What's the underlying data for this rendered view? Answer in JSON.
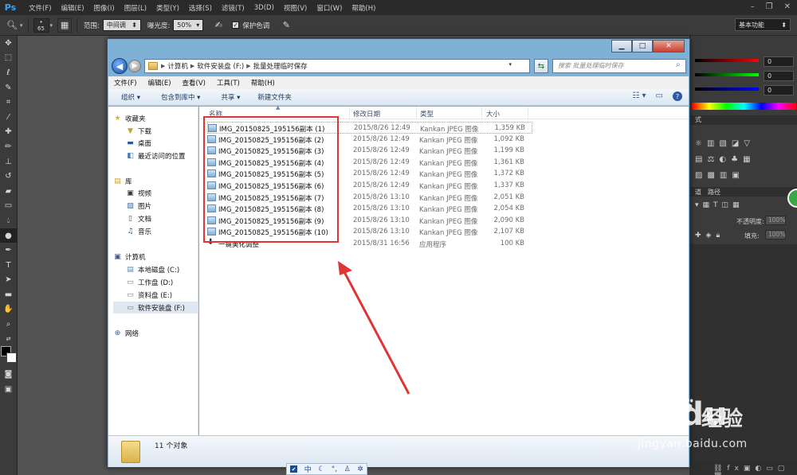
{
  "photoshop": {
    "logo": "Ps",
    "menu": [
      "文件(F)",
      "编辑(E)",
      "图像(I)",
      "图层(L)",
      "类型(Y)",
      "选择(S)",
      "滤镜(T)",
      "3D(D)",
      "视图(V)",
      "窗口(W)",
      "帮助(H)"
    ],
    "options": {
      "brush_size": "65",
      "range_label": "范围:",
      "range_value": "中间调",
      "exposure_label": "曝光度:",
      "exposure_value": "50%",
      "protect_tone_label": "保护色调"
    },
    "workspace": "基本功能",
    "right_panel": {
      "values": [
        "0",
        "0",
        "0"
      ],
      "tab_label": "式",
      "tabs2": [
        "道",
        "路径"
      ],
      "opacity_label": "不透明度:",
      "opacity_value": "100%",
      "fill_label": "填充:",
      "fill_value": "100%"
    },
    "accent_colors": {
      "blue": "#31a8ff",
      "green_badge": "#3aa845"
    }
  },
  "explorer": {
    "breadcrumb": [
      "计算机",
      "软件安装盘 (F:)",
      "批量处理临时保存"
    ],
    "search_placeholder": "搜索 批量处理临时保存",
    "menu": [
      "文件(F)",
      "编辑(E)",
      "查看(V)",
      "工具(T)",
      "帮助(H)"
    ],
    "commands": [
      "组织 ▾",
      "包含到库中 ▾",
      "共享 ▾",
      "新建文件夹"
    ],
    "nav": {
      "favorites": {
        "label": "收藏夹",
        "items": [
          "下载",
          "桌面",
          "最近访问的位置"
        ]
      },
      "libraries": {
        "label": "库",
        "items": [
          "视频",
          "图片",
          "文档",
          "音乐"
        ]
      },
      "computer": {
        "label": "计算机",
        "items": [
          "本地磁盘 (C:)",
          "工作盘 (D:)",
          "资料盘 (E:)",
          "软件安装盘 (F:)"
        ]
      },
      "network": {
        "label": "网络"
      }
    },
    "columns": {
      "name": "名称",
      "date": "修改日期",
      "type": "类型",
      "size": "大小"
    },
    "files": [
      {
        "name": "IMG_20150825_195156副本 (1)",
        "date": "2015/8/26 12:49",
        "type": "Kankan JPEG 图像",
        "size": "1,359 KB"
      },
      {
        "name": "IMG_20150825_195156副本 (2)",
        "date": "2015/8/26 12:49",
        "type": "Kankan JPEG 图像",
        "size": "1,092 KB"
      },
      {
        "name": "IMG_20150825_195156副本 (3)",
        "date": "2015/8/26 12:49",
        "type": "Kankan JPEG 图像",
        "size": "1,199 KB"
      },
      {
        "name": "IMG_20150825_195156副本 (4)",
        "date": "2015/8/26 12:49",
        "type": "Kankan JPEG 图像",
        "size": "1,361 KB"
      },
      {
        "name": "IMG_20150825_195156副本 (5)",
        "date": "2015/8/26 12:49",
        "type": "Kankan JPEG 图像",
        "size": "1,372 KB"
      },
      {
        "name": "IMG_20150825_195156副本 (6)",
        "date": "2015/8/26 12:49",
        "type": "Kankan JPEG 图像",
        "size": "1,337 KB"
      },
      {
        "name": "IMG_20150825_195156副本 (7)",
        "date": "2015/8/26 13:10",
        "type": "Kankan JPEG 图像",
        "size": "2,051 KB"
      },
      {
        "name": "IMG_20150825_195156副本 (8)",
        "date": "2015/8/26 13:10",
        "type": "Kankan JPEG 图像",
        "size": "2,054 KB"
      },
      {
        "name": "IMG_20150825_195156副本 (9)",
        "date": "2015/8/26 13:10",
        "type": "Kankan JPEG 图像",
        "size": "2,090 KB"
      },
      {
        "name": "IMG_20150825_195156副本 (10)",
        "date": "2015/8/26 13:10",
        "type": "Kankan JPEG 图像",
        "size": "2,107 KB"
      },
      {
        "name": "一键美化调整",
        "date": "2015/8/31 16:56",
        "type": "应用程序",
        "size": "100 KB"
      }
    ],
    "status": "11 个对象",
    "annotation_color": "#e03535"
  },
  "ime_bar": [
    "中"
  ],
  "watermark": {
    "brand_a": "Bai",
    "brand_b": "du",
    "brand_cn": "经验",
    "url": "jingyan.baidu.com"
  }
}
